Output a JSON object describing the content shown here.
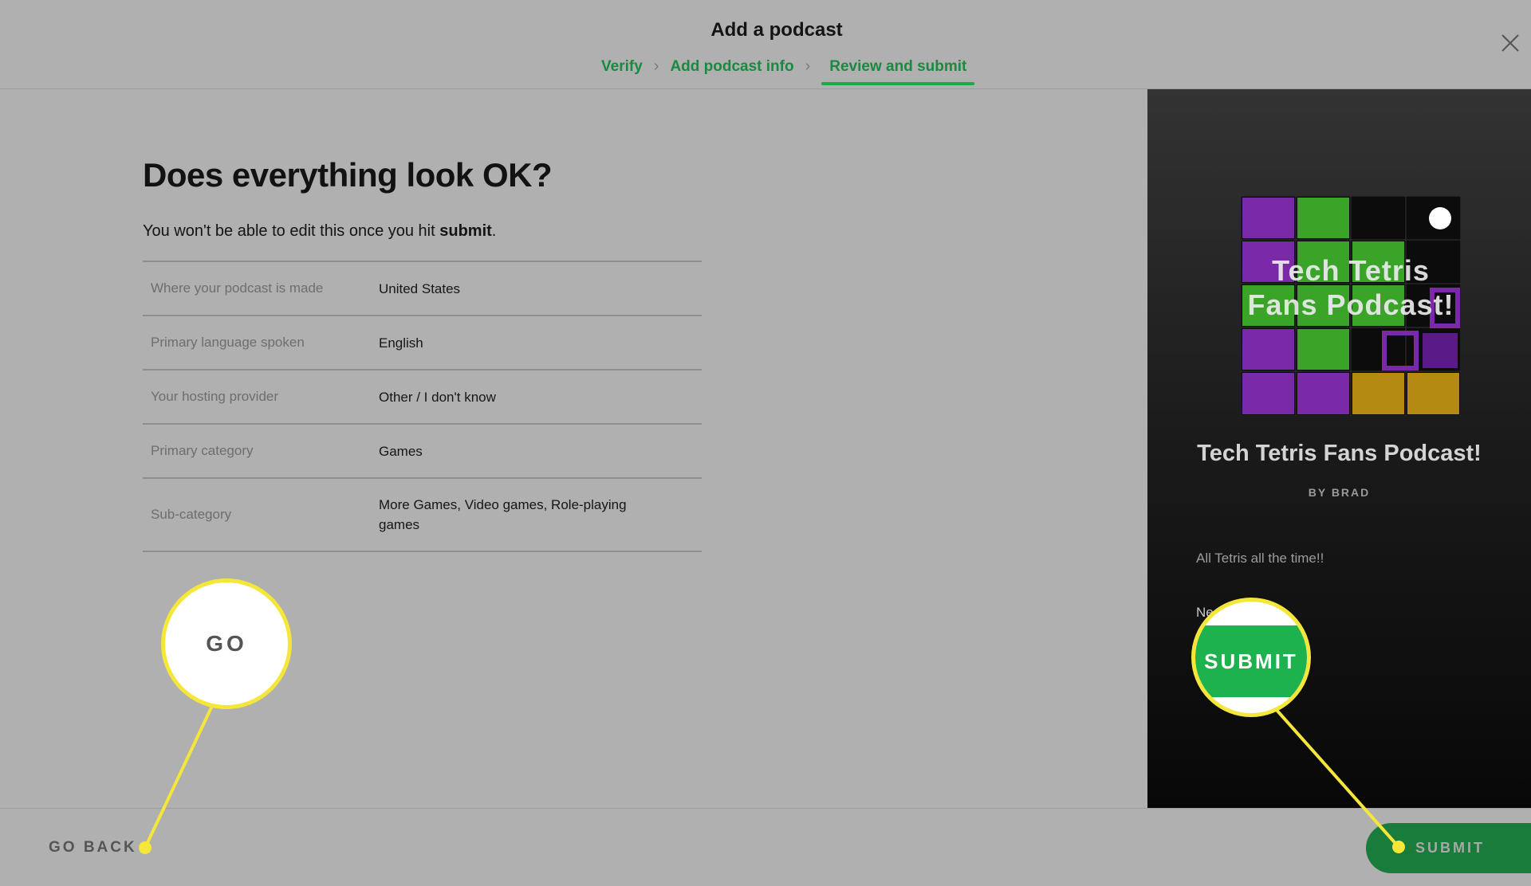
{
  "header": {
    "title": "Add a podcast",
    "steps": [
      {
        "label": "Verify"
      },
      {
        "label": "Add podcast info"
      },
      {
        "label": "Review and submit"
      }
    ]
  },
  "main": {
    "heading": "Does everything look OK?",
    "subtext_prefix": "You won't be able to edit this once you hit ",
    "subtext_bold": "submit",
    "subtext_suffix": ".",
    "rows": [
      {
        "label": "Where your podcast is made",
        "value": "United States"
      },
      {
        "label": "Primary language spoken",
        "value": "English"
      },
      {
        "label": "Your hosting provider",
        "value": "Other / I don't know"
      },
      {
        "label": "Primary category",
        "value": "Games"
      },
      {
        "label": "Sub-category",
        "value": "More Games, Video games, Role-playing games"
      }
    ]
  },
  "preview": {
    "cover_text": "Tech Tetris Fans Podcast!",
    "name": "Tech Tetris Fans Podcast!",
    "author": "BY BRAD",
    "description": "All Tetris all the time!!",
    "description_line2": "Ne"
  },
  "footer": {
    "go_back_label": "GO BACK",
    "submit_label": "SUBMIT"
  },
  "callouts": {
    "go_back_zoom": "GO BACK",
    "submit_zoom": "SUBMIT",
    "highlight_color": "#f5e63a"
  },
  "colors": {
    "accent_green": "#1ea84a",
    "submit_green": "#1a7c3a"
  }
}
